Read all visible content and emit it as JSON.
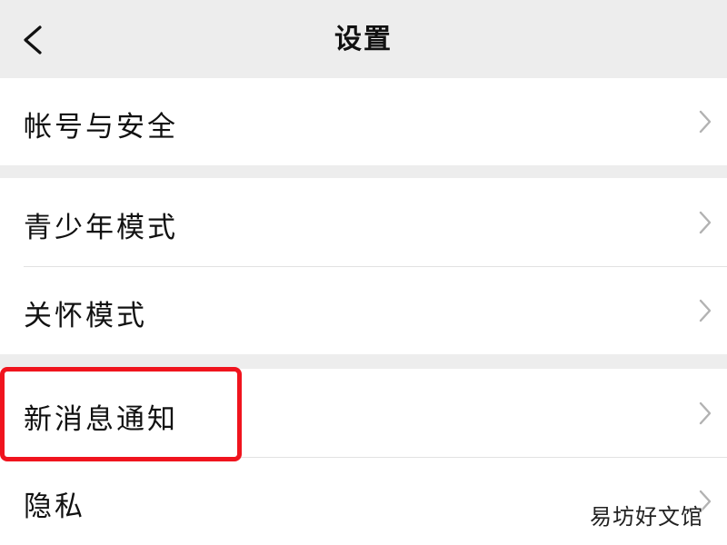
{
  "nav": {
    "title": "设置",
    "back_icon": "chevron-left-icon"
  },
  "groups": [
    {
      "items": [
        {
          "label": "帐号与安全",
          "icon": "chevron-right-icon"
        }
      ]
    },
    {
      "items": [
        {
          "label": "青少年模式",
          "icon": "chevron-right-icon"
        },
        {
          "label": "关怀模式",
          "icon": "chevron-right-icon"
        }
      ]
    },
    {
      "items": [
        {
          "label": "新消息通知",
          "icon": "chevron-right-icon"
        },
        {
          "label": "隐私",
          "icon": "chevron-right-icon"
        }
      ]
    }
  ],
  "annotation": {
    "highlight_color": "#f0141e",
    "highlighted_item": "新消息通知"
  },
  "watermark": {
    "text": "易坊好文馆"
  },
  "colors": {
    "background": "#ededed",
    "surface": "#ffffff",
    "text": "#111111",
    "chevron": "#b2b2b2"
  }
}
